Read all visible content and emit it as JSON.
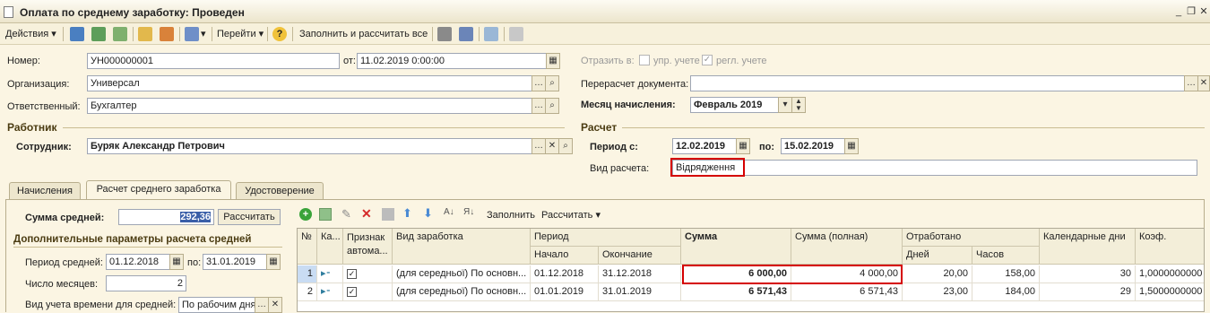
{
  "window": {
    "title": "Оплата по среднему заработку: Проведен"
  },
  "toolbar": {
    "actions": "Действия",
    "goto": "Перейти",
    "fill_calc": "Заполнить и рассчитать все"
  },
  "header": {
    "number_label": "Номер:",
    "number_value": "УН000000001",
    "date_label": "от:",
    "date_value": "11.02.2019  0:00:00",
    "org_label": "Организация:",
    "org_value": "Универсал",
    "resp_label": "Ответственный:",
    "resp_value": "Бухгалтер",
    "reflect_label": "Отразить в:",
    "reflect_mgmt": "упр. учете",
    "reflect_reg": "регл. учете",
    "recalc_label": "Перерасчет документа:",
    "recalc_value": "",
    "month_label": "Месяц начисления:",
    "month_value": "Февраль 2019"
  },
  "worker": {
    "section": "Работник",
    "employee_label": "Сотрудник:",
    "employee_value": "Буряк Александр Петрович"
  },
  "calc": {
    "section": "Расчет",
    "period_from_label": "Период с:",
    "period_from": "12.02.2019",
    "period_to_label": "по:",
    "period_to": "15.02.2019",
    "type_label": "Вид расчета:",
    "type_value": "Відрядження"
  },
  "tabs": [
    "Начисления",
    "Расчет среднего заработка",
    "Удостоверение"
  ],
  "avg": {
    "sum_label": "Сумма средней:",
    "sum_value": "292,36",
    "calc_button": "Рассчитать",
    "params_title": "Дополнительные параметры расчета средней",
    "period_label": "Период средней:",
    "period_from": "01.12.2018",
    "to_label": "по:",
    "period_to": "31.01.2019",
    "months_label": "Число месяцев:",
    "months_value": "2",
    "time_label": "Вид учета времени для средней:",
    "time_value": "По рабочим дням"
  },
  "grid_toolbar": {
    "fill": "Заполнить",
    "calculate": "Рассчитать"
  },
  "grid": {
    "headers": {
      "n": "№",
      "ka": "Ка...",
      "sign": "Признак автома...",
      "type": "Вид заработка",
      "period": "Период",
      "start": "Начало",
      "end": "Окончание",
      "sum": "Сумма",
      "sum_full": "Сумма (полная)",
      "worked": "Отработано",
      "days": "Дней",
      "hours": "Часов",
      "cal_days": "Календарные дни",
      "coef": "Коэф."
    },
    "rows": [
      {
        "n": "1",
        "type": "(для середньої) По основн...",
        "start": "01.12.2018",
        "end": "31.12.2018",
        "sum": "6 000,00",
        "sum_full": "4 000,00",
        "days": "20,00",
        "hours": "158,00",
        "cal": "30",
        "coef": "1,0000000000"
      },
      {
        "n": "2",
        "type": "(для середньої) По основн...",
        "start": "01.01.2019",
        "end": "31.01.2019",
        "sum": "6 571,43",
        "sum_full": "6 571,43",
        "days": "23,00",
        "hours": "184,00",
        "cal": "29",
        "coef": "1,5000000000"
      }
    ]
  }
}
